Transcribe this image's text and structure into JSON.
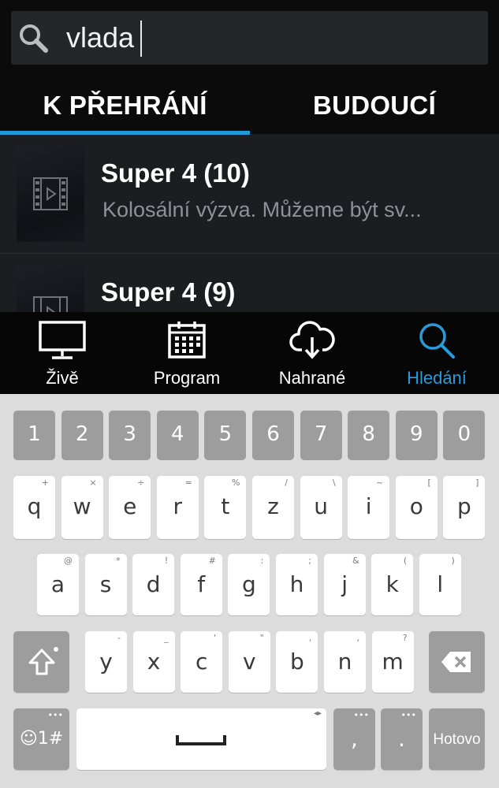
{
  "search": {
    "query": "vlada"
  },
  "tabs": [
    {
      "label": "K PŘEHRÁNÍ",
      "active": true
    },
    {
      "label": "BUDOUCÍ",
      "active": false
    }
  ],
  "results": [
    {
      "title": "Super 4 (10)",
      "subtitle": "Kolosální výzva. Můžeme být sv..."
    },
    {
      "title": "Super 4 (9)",
      "subtitle": ""
    }
  ],
  "nav": [
    {
      "label": "Živě",
      "icon": "tv-icon"
    },
    {
      "label": "Program",
      "icon": "calendar-icon"
    },
    {
      "label": "Nahrané",
      "icon": "cloud-download-icon"
    },
    {
      "label": "Hledání",
      "icon": "search-icon",
      "active": true
    }
  ],
  "keyboard": {
    "numbers": [
      "1",
      "2",
      "3",
      "4",
      "5",
      "6",
      "7",
      "8",
      "9",
      "0"
    ],
    "row1": [
      {
        "k": "q",
        "h": "+"
      },
      {
        "k": "w",
        "h": "×"
      },
      {
        "k": "e",
        "h": "÷"
      },
      {
        "k": "r",
        "h": "="
      },
      {
        "k": "t",
        "h": "%"
      },
      {
        "k": "z",
        "h": "/"
      },
      {
        "k": "u",
        "h": "\\"
      },
      {
        "k": "i",
        "h": "~"
      },
      {
        "k": "o",
        "h": "["
      },
      {
        "k": "p",
        "h": "]"
      }
    ],
    "row2": [
      {
        "k": "a",
        "h": "@"
      },
      {
        "k": "s",
        "h": "*"
      },
      {
        "k": "d",
        "h": "!"
      },
      {
        "k": "f",
        "h": "#"
      },
      {
        "k": "g",
        "h": ":"
      },
      {
        "k": "h",
        "h": ";"
      },
      {
        "k": "j",
        "h": "&"
      },
      {
        "k": "k",
        "h": "("
      },
      {
        "k": "l",
        "h": ")"
      }
    ],
    "row3": [
      {
        "k": "y",
        "h": "-"
      },
      {
        "k": "x",
        "h": "_"
      },
      {
        "k": "c",
        "h": "'"
      },
      {
        "k": "v",
        "h": "\""
      },
      {
        "k": "b",
        "h": ","
      },
      {
        "k": "n",
        "h": ","
      },
      {
        "k": "m",
        "h": "?"
      }
    ],
    "emoji_label": "☺1#",
    "comma": ",",
    "period": ".",
    "done_label": "Hotovo"
  },
  "colors": {
    "accent": "#1f9ad6",
    "background": "#1a1c1e",
    "keyboard_bg": "#dcdcdc"
  }
}
